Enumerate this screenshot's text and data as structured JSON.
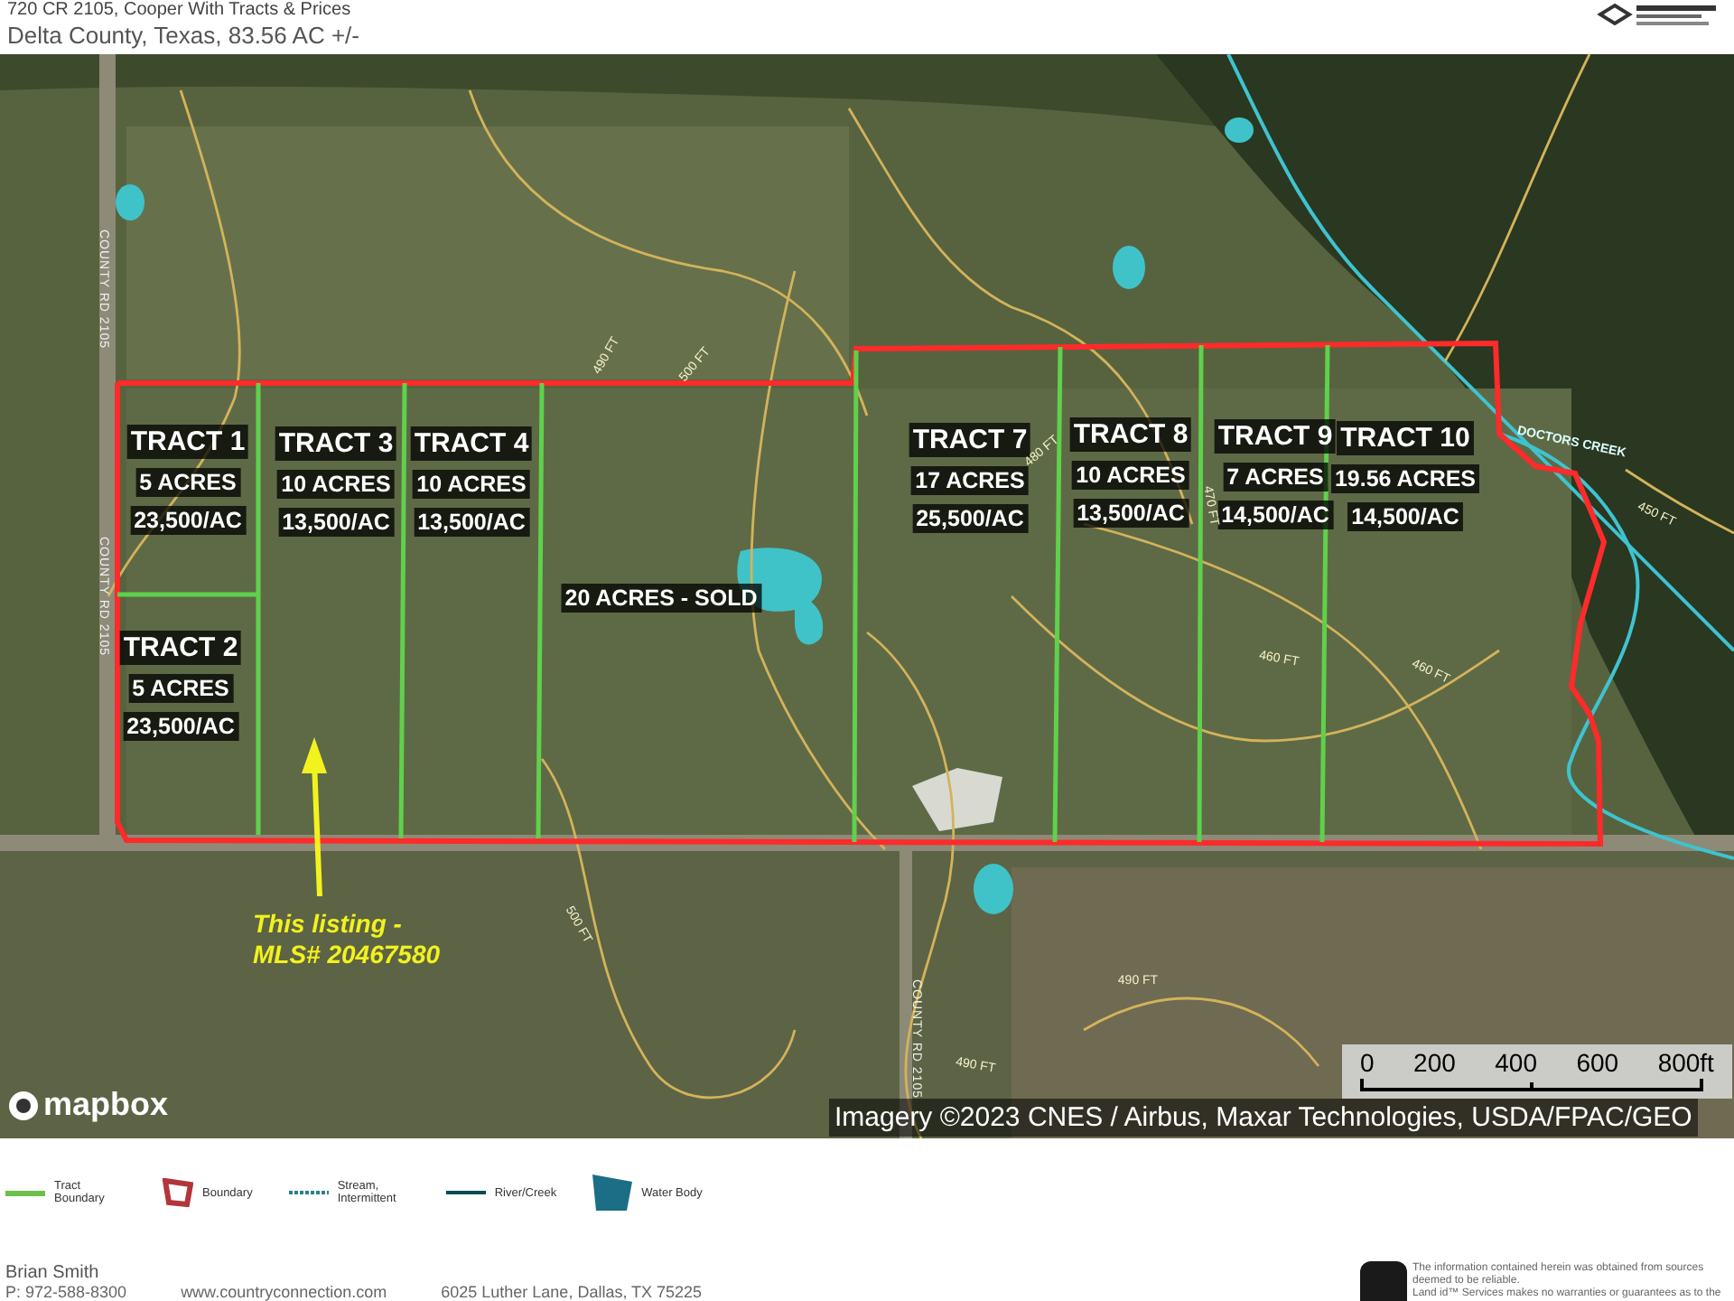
{
  "header": {
    "title": "720 CR 2105, Cooper With Tracts & Prices",
    "subtitle": "Delta County, Texas, 83.56 AC +/-"
  },
  "map": {
    "tracts": [
      {
        "name": "TRACT 1",
        "acres": "5 ACRES",
        "price": "23,500/AC"
      },
      {
        "name": "TRACT 2",
        "acres": "5 ACRES",
        "price": "23,500/AC"
      },
      {
        "name": "TRACT 3",
        "acres": "10 ACRES",
        "price": "13,500/AC"
      },
      {
        "name": "TRACT 4",
        "acres": "10 ACRES",
        "price": "13,500/AC"
      },
      {
        "name": "TRACT 7",
        "acres": "17 ACRES",
        "price": "25,500/AC"
      },
      {
        "name": "TRACT 8",
        "acres": "10 ACRES",
        "price": "13,500/AC"
      },
      {
        "name": "TRACT 9",
        "acres": "7 ACRES",
        "price": "14,500/AC"
      },
      {
        "name": "TRACT 10",
        "acres": "19.56 ACRES",
        "price": "14,500/AC"
      }
    ],
    "sold_label": "20 ACRES - SOLD",
    "listing_callout": [
      "This listing -",
      "MLS# 20467580"
    ],
    "road_labels": [
      "COUNTY RD 2105",
      "COUNTY RD 2105",
      "COUNTY RD 2105"
    ],
    "creek_label": "DOCTORS CREEK",
    "contour_labels": [
      "490 FT",
      "480 FT",
      "470 FT",
      "460 FT",
      "460 FT",
      "450 FT",
      "500 FT",
      "490 FT",
      "490 FT",
      "500 FT"
    ],
    "logo": "mapbox",
    "attribution": "Imagery ©2023 CNES / Airbus, Maxar Technologies, USDA/FPAC/GEO",
    "scale": [
      "0",
      "200",
      "400",
      "600",
      "800ft"
    ]
  },
  "legend": [
    {
      "kind": "tract",
      "label": "Tract Boundary"
    },
    {
      "kind": "boundary",
      "label": "Boundary"
    },
    {
      "kind": "stream",
      "label": "Stream, Intermittent"
    },
    {
      "kind": "river",
      "label": "River/Creek"
    },
    {
      "kind": "water",
      "label": "Water Body"
    }
  ],
  "footer": {
    "agent": "Brian Smith",
    "phone": "P: 972-588-8300",
    "website": "www.countryconnection.com",
    "address": "6025 Luther Lane, Dallas, TX 75225",
    "disclaimer": [
      "The information contained herein was obtained from sources deemed to be reliable.",
      "Land id™ Services makes no warranties or guarantees as to the"
    ]
  }
}
